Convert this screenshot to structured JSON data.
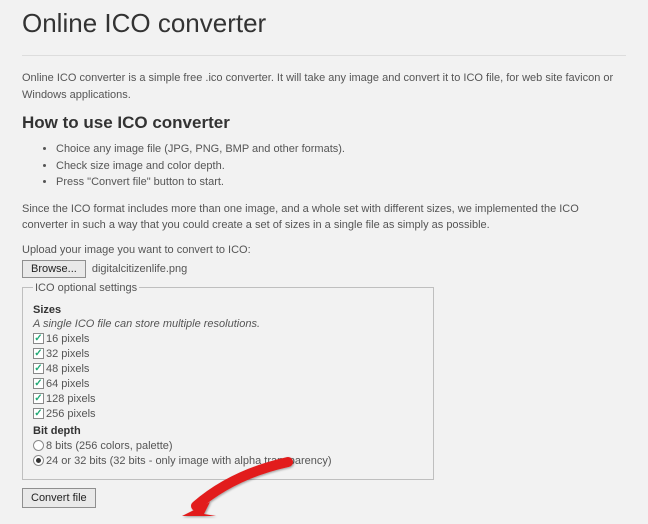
{
  "title": "Online ICO converter",
  "intro": "Online ICO converter is a simple free .ico converter. It will take any image and convert it to ICO file, for web site favicon or Windows applications.",
  "howto_heading": "How to use ICO converter",
  "steps": [
    "Choice any image file (JPG, PNG, BMP and other formats).",
    "Check size image and color depth.",
    "Press \"Convert file\" button to start."
  ],
  "explain": "Since the ICO format includes more than one image, and a whole set with different sizes, we implemented the ICO converter in such a way that you could create a set of sizes in a single file as simply as possible.",
  "upload_label": "Upload your image you want to convert to ICO:",
  "browse_label": "Browse...",
  "filename": "digitalcitizenlife.png",
  "fieldset_legend": "ICO optional settings",
  "sizes_head": "Sizes",
  "sizes_sub": "A single ICO file can store multiple resolutions.",
  "sizes": [
    {
      "label": "16 pixels",
      "checked": true
    },
    {
      "label": "32 pixels",
      "checked": true
    },
    {
      "label": "48 pixels",
      "checked": true
    },
    {
      "label": "64 pixels",
      "checked": true
    },
    {
      "label": "128 pixels",
      "checked": true
    },
    {
      "label": "256 pixels",
      "checked": true
    }
  ],
  "bitdepth_head": "Bit depth",
  "bitdepths": [
    {
      "label": "8 bits (256 colors, palette)",
      "checked": false
    },
    {
      "label": "24 or 32 bits (32 bits - only image with alpha transparency)",
      "checked": true
    }
  ],
  "convert_label": "Convert file"
}
